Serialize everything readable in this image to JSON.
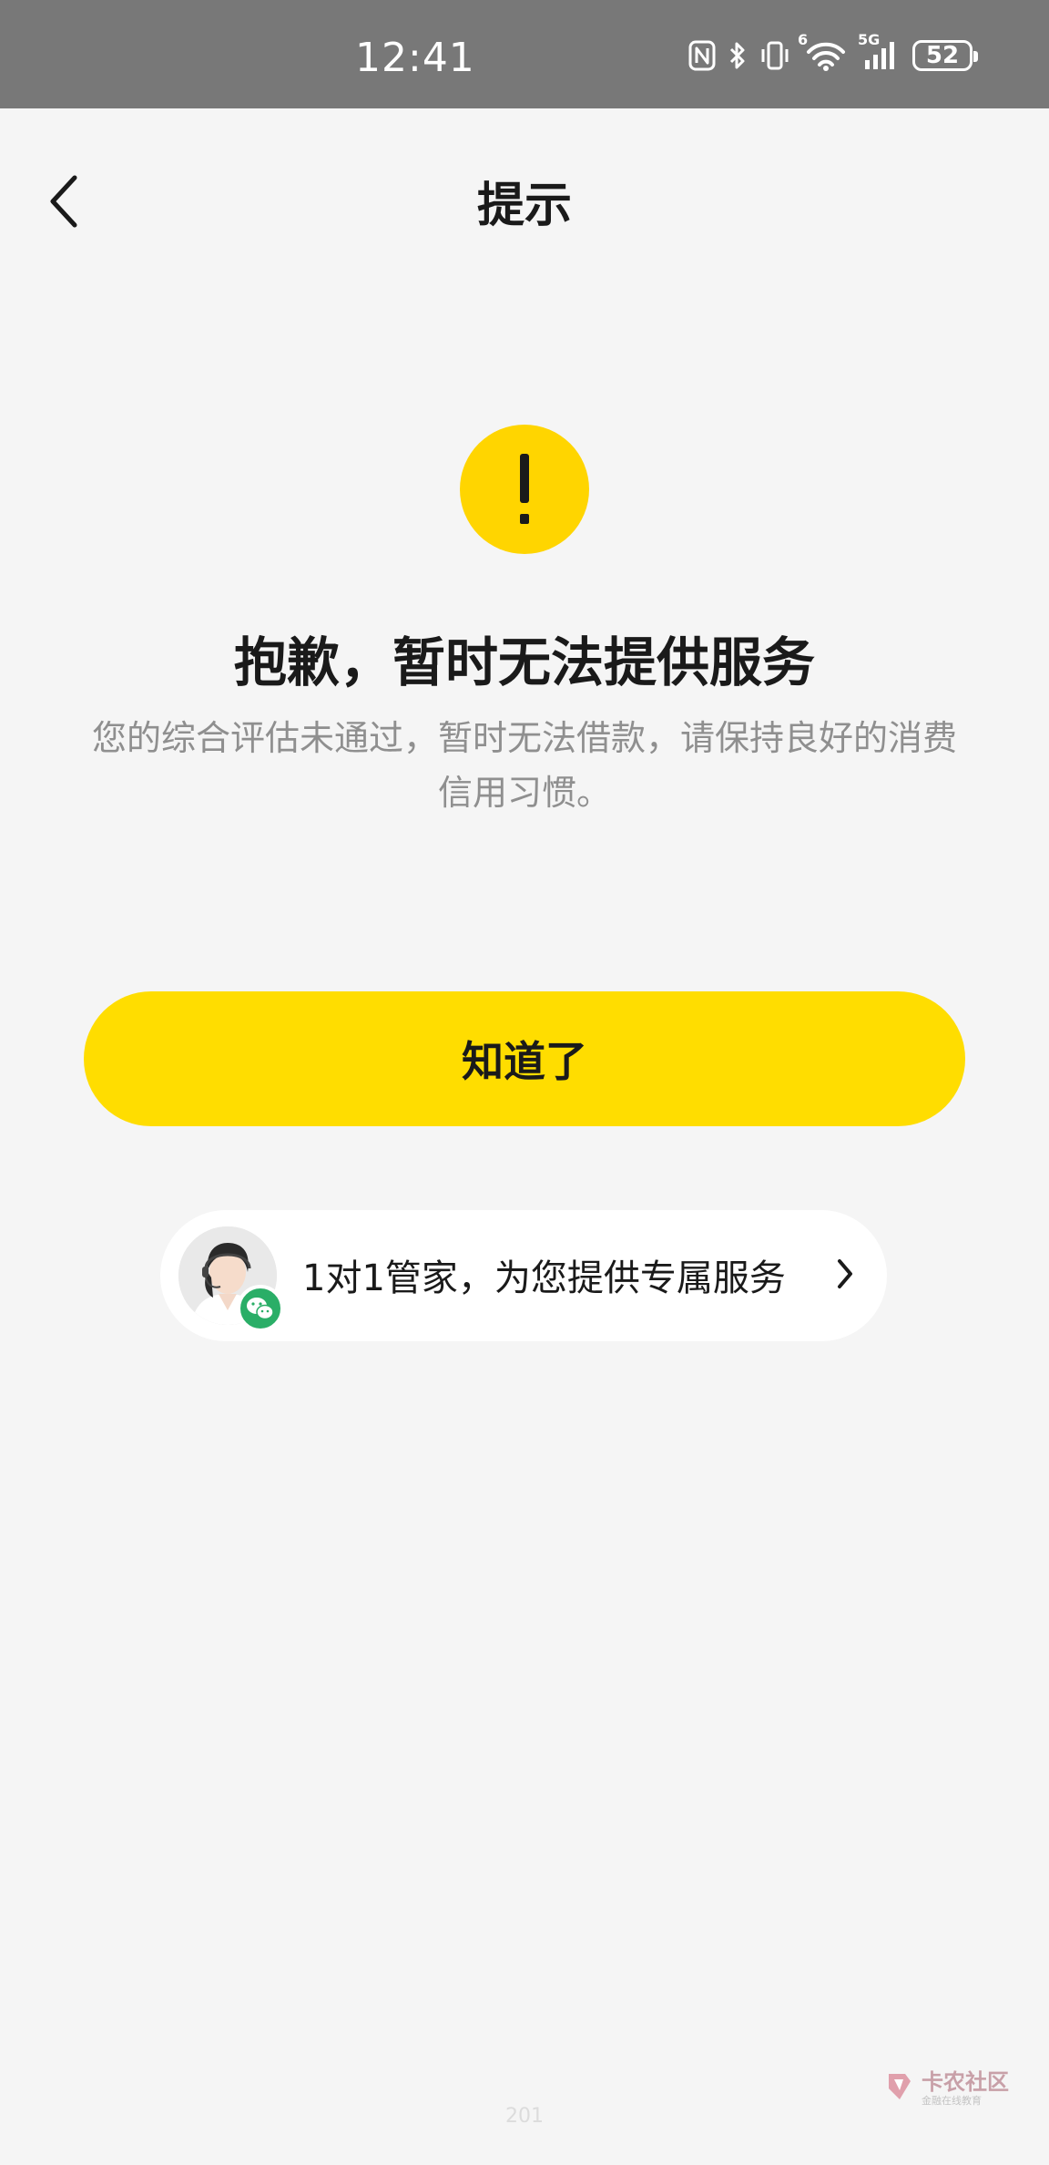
{
  "status_bar": {
    "time": "12:41",
    "battery": "52",
    "signal_labels": [
      "6",
      "5G"
    ],
    "icons": [
      "nfc-icon",
      "bluetooth-icon",
      "vibrate-icon",
      "wifi-icon",
      "cellular-signal-icon",
      "battery-icon"
    ]
  },
  "nav": {
    "title": "提示",
    "back_icon": "chevron-left-icon"
  },
  "result": {
    "icon": "exclamation-icon",
    "accent_color": "#ffd500",
    "headline": "抱歉，暂时无法提供服务",
    "description": "您的综合评估未通过，暂时无法借款，请保持良好的消费信用习惯。"
  },
  "primary_button": {
    "label": "知道了",
    "color": "#ffdd00"
  },
  "butler": {
    "label": "1对1管家，为您提供专属服务",
    "avatar_icon": "customer-service-avatar",
    "badge_icon": "wechat-icon",
    "badge_color": "#2aae67",
    "arrow_icon": "chevron-right-icon"
  },
  "footer": {
    "code": "201"
  },
  "watermark": {
    "title": "卡农社区",
    "subtitle": "金融在线教育"
  }
}
